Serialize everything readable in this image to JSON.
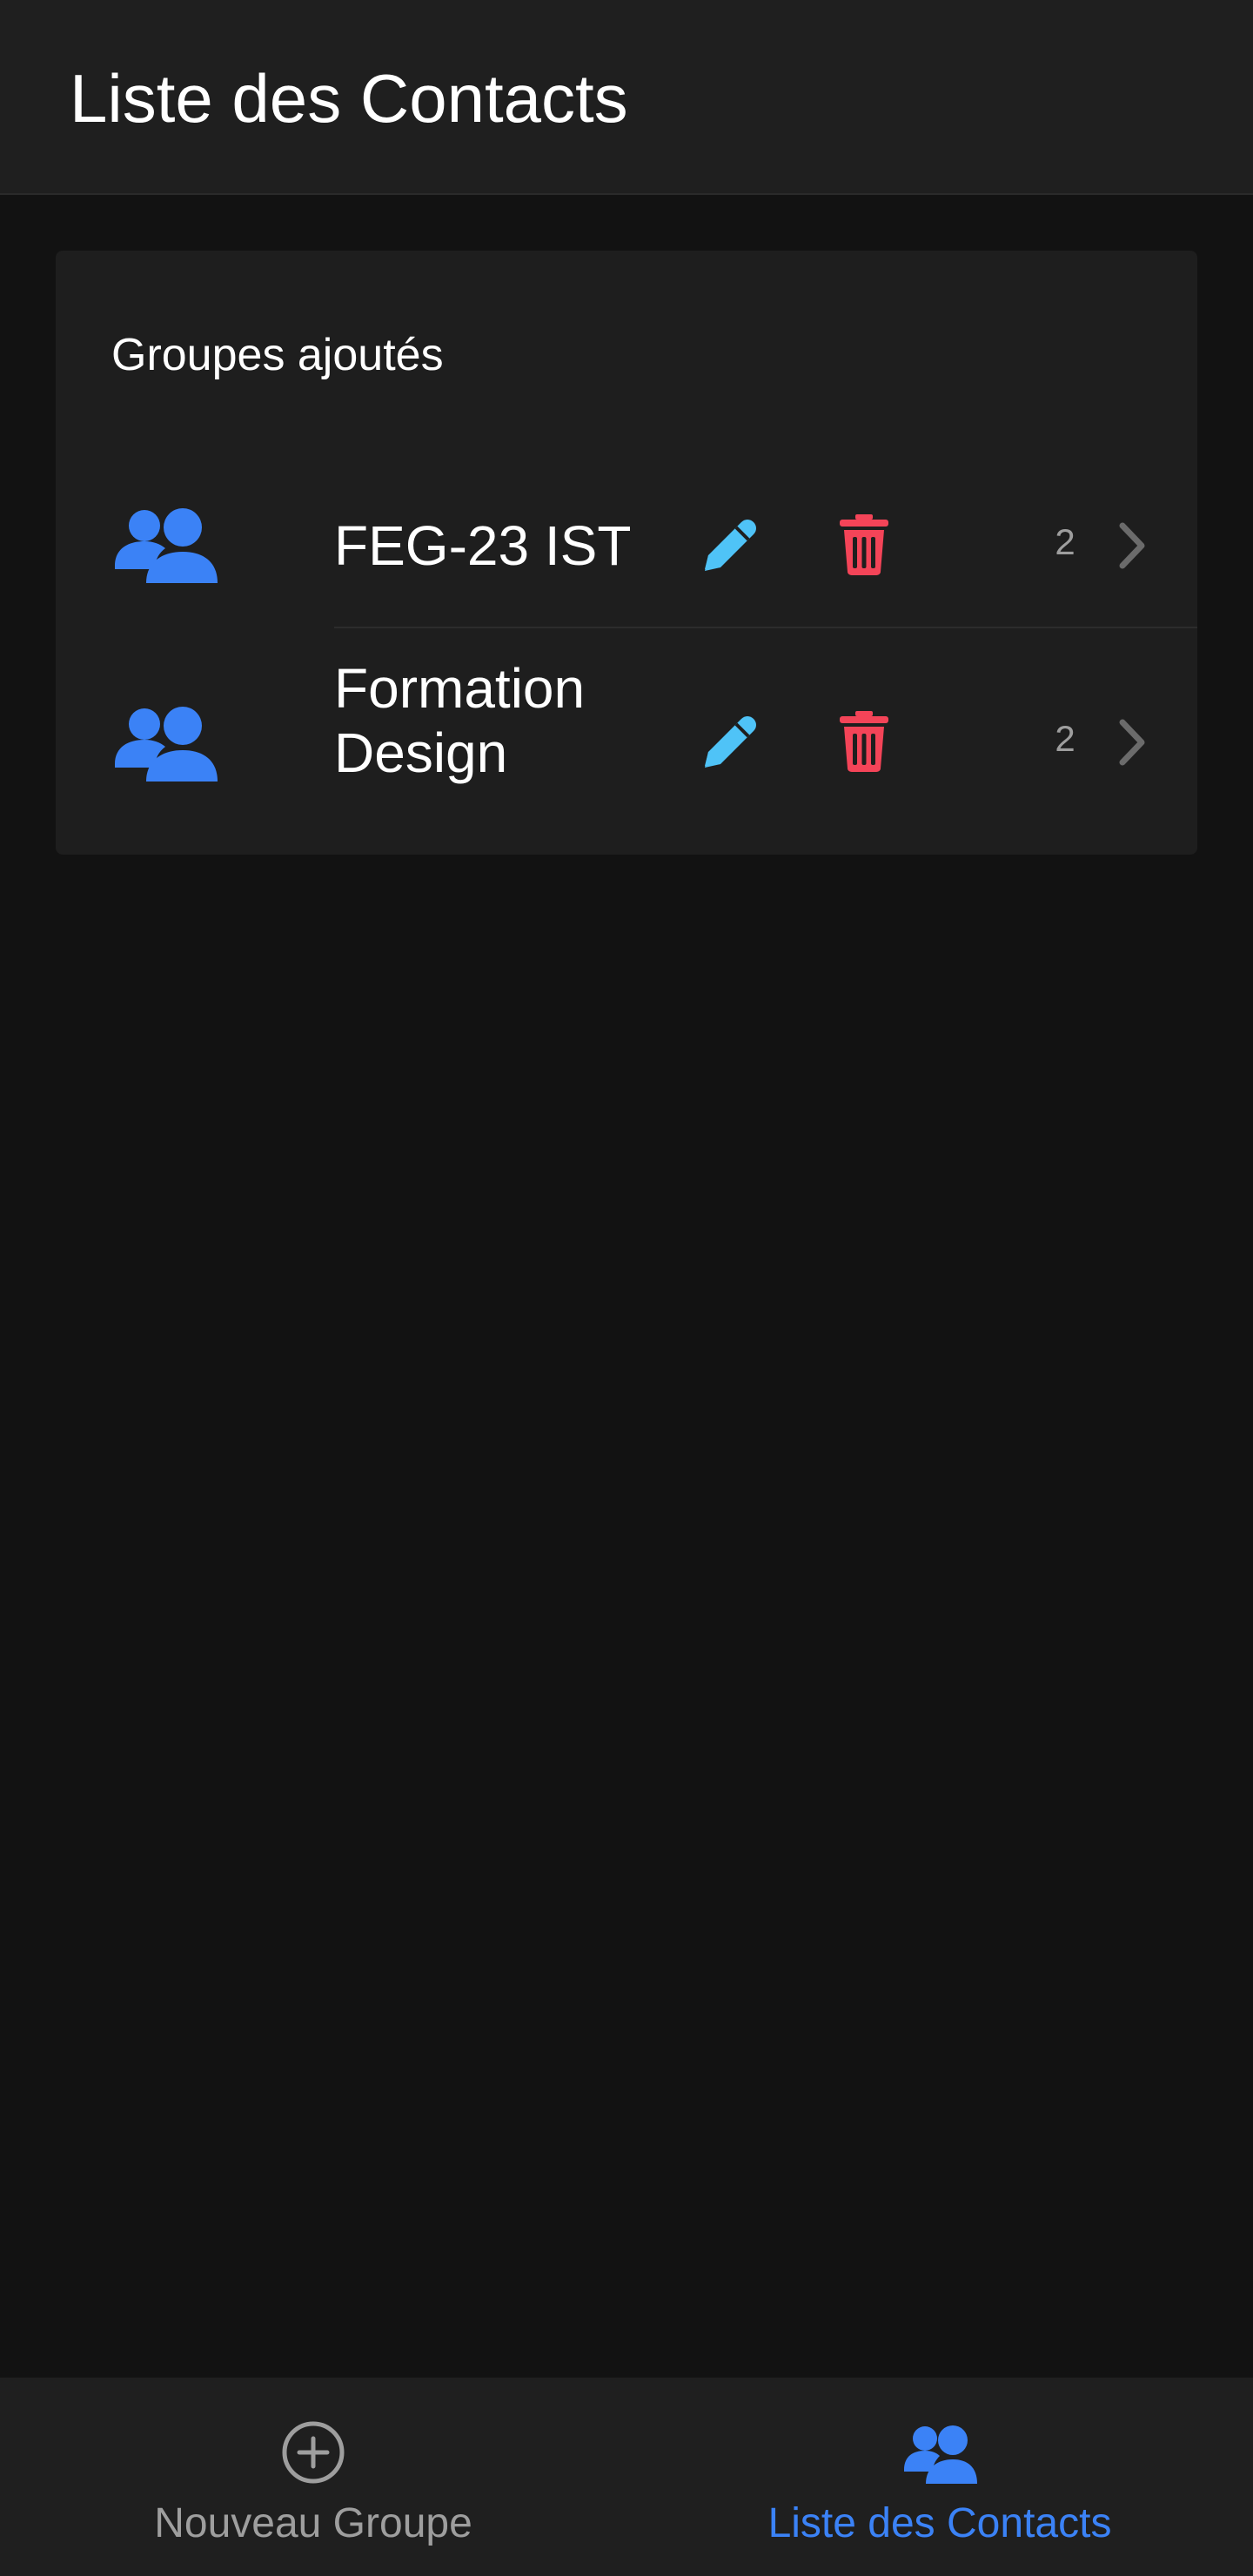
{
  "header": {
    "title": "Liste des Contacts"
  },
  "card": {
    "title": "Groupes ajoutés",
    "groups": [
      {
        "name": "FEG-23 IST",
        "count": "2"
      },
      {
        "name": "Formation Design",
        "count": "2"
      }
    ]
  },
  "icons": {
    "group": "group-icon",
    "edit": "pencil-icon",
    "delete": "trash-icon",
    "open": "chevron-right-icon",
    "add": "plus-circle-icon"
  },
  "colors": {
    "accent_blue": "#3b82f6",
    "edit_blue": "#4fc3f7",
    "delete_red": "#f44458",
    "background": "#121212",
    "surface": "#1e1e1e"
  },
  "bottom_nav": {
    "items": [
      {
        "label": "Nouveau Groupe",
        "active": false
      },
      {
        "label": "Liste des Contacts",
        "active": true
      }
    ]
  }
}
